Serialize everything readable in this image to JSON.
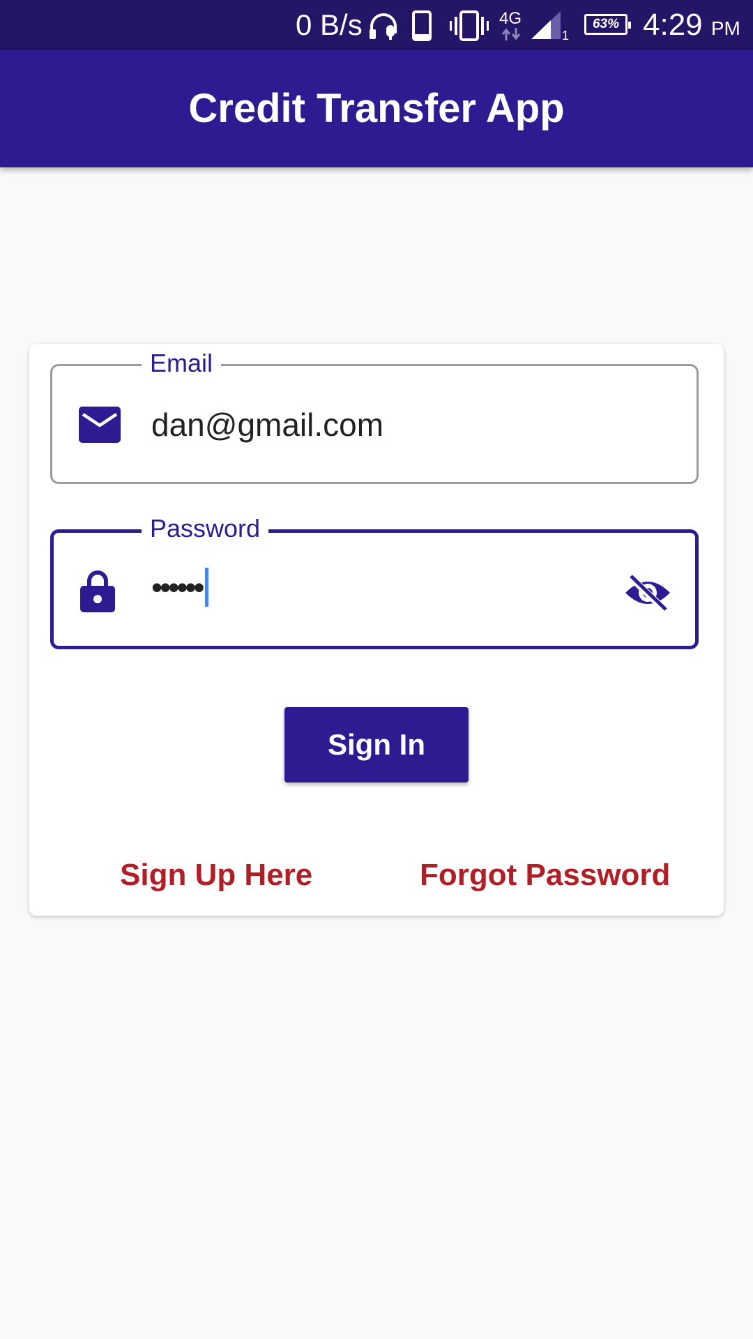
{
  "status_bar": {
    "network_speed": "0 B/s",
    "network_type": "4G",
    "sim_slot": "1",
    "battery_percent": "63%",
    "time": "4:29",
    "ampm": "PM"
  },
  "app_bar": {
    "title": "Credit Transfer App"
  },
  "login_form": {
    "email": {
      "label": "Email",
      "value": "dan@gmail.com",
      "icon": "mail-icon"
    },
    "password": {
      "label": "Password",
      "masked_value": "••••••",
      "icon": "lock-icon",
      "toggle_icon": "visibility-off-icon"
    },
    "sign_in_label": "Sign In",
    "sign_up_link": "Sign Up Here",
    "forgot_password_link": "Forgot Password"
  },
  "colors": {
    "primary": "#2e1a91",
    "primary_dark": "#241566",
    "link": "#b01f26",
    "background": "#f9f9f9"
  }
}
